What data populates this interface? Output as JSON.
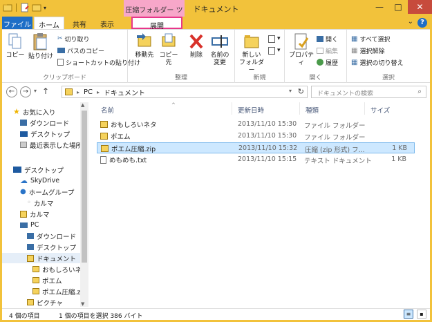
{
  "window": {
    "title": "ドキュメント",
    "context_tool_label": "圧縮フォルダー ツール",
    "colors": {
      "frame": "#f2c23b",
      "file_tab": "#1e6ec6",
      "context_tab": "#f7a7c9",
      "highlight_border": "#e8378a",
      "selection": "#cde8ff"
    }
  },
  "tabs": {
    "file": "ファイル",
    "home": "ホーム",
    "share": "共有",
    "view": "表示",
    "expand": "展開"
  },
  "ribbon": {
    "clipboard": {
      "copy": "コピー",
      "paste": "貼り付け",
      "cut": "切り取り",
      "copy_path": "パスのコピー",
      "paste_shortcut": "ショートカットの貼り付け",
      "label": "クリップボード"
    },
    "organize": {
      "move_to": "移動先",
      "copy_to": "コピー先",
      "delete": "削除",
      "rename_line1": "名前の",
      "rename_line2": "変更",
      "label": "整理"
    },
    "new": {
      "new_folder_line1": "新しい",
      "new_folder_line2": "フォルダー",
      "label": "新規"
    },
    "open": {
      "properties": "プロパティ",
      "open": "開く",
      "edit": "編集",
      "history": "履歴",
      "label": "開く"
    },
    "select": {
      "select_all": "すべて選択",
      "select_none": "選択解除",
      "invert": "選択の切り替え",
      "label": "選択"
    }
  },
  "address": {
    "path": [
      "PC",
      "ドキュメント"
    ],
    "search_placeholder": "ドキュメントの検索"
  },
  "nav": {
    "items": [
      {
        "label": "お気に入り",
        "icon": "star-icon"
      },
      {
        "label": "ダウンロード",
        "icon": "download-folder-icon"
      },
      {
        "label": "デスクトップ",
        "icon": "desktop-icon"
      },
      {
        "label": "最近表示した場所",
        "icon": "recent-places-icon"
      },
      {
        "label": "デスクトップ",
        "icon": "desktop-icon"
      },
      {
        "label": "SkyDrive",
        "icon": "cloud-icon"
      },
      {
        "label": "ホームグループ",
        "icon": "homegroup-icon"
      },
      {
        "label": "カルマ",
        "icon": "user-icon"
      },
      {
        "label": "カルマ",
        "icon": "user-folder-icon"
      },
      {
        "label": "PC",
        "icon": "computer-icon"
      },
      {
        "label": "ダウンロード",
        "icon": "download-folder-icon"
      },
      {
        "label": "デスクトップ",
        "icon": "desktop-folder-icon"
      },
      {
        "label": "ドキュメント",
        "icon": "documents-folder-icon"
      },
      {
        "label": "おもしろいネタ",
        "icon": "folder-icon"
      },
      {
        "label": "ポエム",
        "icon": "folder-icon"
      },
      {
        "label": "ポエム圧縮.zip",
        "icon": "zip-folder-icon"
      },
      {
        "label": "ピクチャ",
        "icon": "pictures-folder-icon"
      }
    ]
  },
  "files": {
    "columns": {
      "name": "名前",
      "date": "更新日時",
      "type": "種類",
      "size": "サイズ"
    },
    "rows": [
      {
        "name": "おもしろいネタ",
        "date": "2013/11/10 15:30",
        "type": "ファイル フォルダー",
        "size": "",
        "icon": "folder-icon"
      },
      {
        "name": "ポエム",
        "date": "2013/11/10 15:30",
        "type": "ファイル フォルダー",
        "size": "",
        "icon": "folder-icon"
      },
      {
        "name": "ポエム圧縮.zip",
        "date": "2013/11/10 15:32",
        "type": "圧縮 (zip 形式) フ...",
        "size": "1 KB",
        "icon": "zip-folder-icon"
      },
      {
        "name": "めもめも.txt",
        "date": "2013/11/10 15:15",
        "type": "テキスト ドキュメント",
        "size": "1 KB",
        "icon": "text-file-icon"
      }
    ]
  },
  "status": {
    "item_count": "4 個の項目",
    "selection": "1 個の項目を選択  386 バイト"
  }
}
